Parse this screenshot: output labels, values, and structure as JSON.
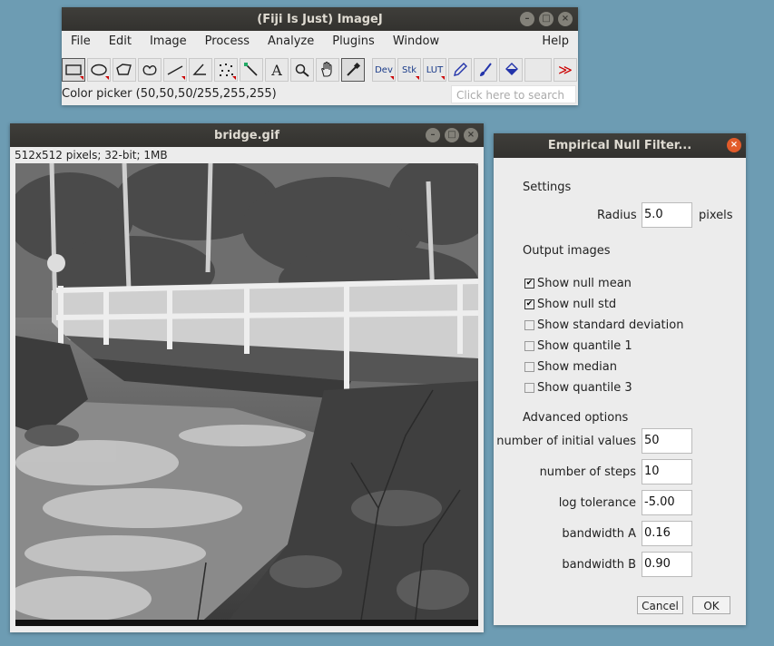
{
  "imagej": {
    "title": "(Fiji Is Just) ImageJ",
    "menus": [
      "File",
      "Edit",
      "Image",
      "Process",
      "Analyze",
      "Plugins",
      "Window"
    ],
    "help_menu": "Help",
    "tools": {
      "text_a": "A",
      "dev": "Dev",
      "stk": "Stk",
      "lut": "LUT",
      "more": "≫"
    },
    "status": "Color picker (50,50,50/255,255,255)",
    "search_placeholder": "Click here to search"
  },
  "image_window": {
    "title": "bridge.gif",
    "info": "512x512 pixels; 32-bit; 1MB"
  },
  "dialog": {
    "title": "Empirical Null Filter...",
    "settings_heading": "Settings",
    "radius_label": "Radius",
    "radius_value": "5.0",
    "radius_unit": "pixels",
    "output_heading": "Output images",
    "checkboxes": [
      {
        "label": "Show null mean",
        "checked": "✔"
      },
      {
        "label": "Show null std",
        "checked": "✔"
      },
      {
        "label": "Show standard deviation",
        "checked": ""
      },
      {
        "label": "Show quantile 1",
        "checked": ""
      },
      {
        "label": "Show median",
        "checked": ""
      },
      {
        "label": "Show quantile 3",
        "checked": ""
      }
    ],
    "advanced_heading": "Advanced options",
    "advanced_fields": [
      {
        "label": "number of initial values",
        "value": "50"
      },
      {
        "label": "number of steps",
        "value": "10"
      },
      {
        "label": "log tolerance",
        "value": "-5.00"
      },
      {
        "label": "bandwidth A",
        "value": "0.16"
      },
      {
        "label": "bandwidth B",
        "value": "0.90"
      }
    ],
    "cancel_label": "Cancel",
    "ok_label": "OK"
  },
  "colors": {
    "desktop": "#6d9cb3",
    "titlebar": "#3a3936",
    "close_button": "#e25b2a",
    "tool_arrow": "#cc0000"
  }
}
